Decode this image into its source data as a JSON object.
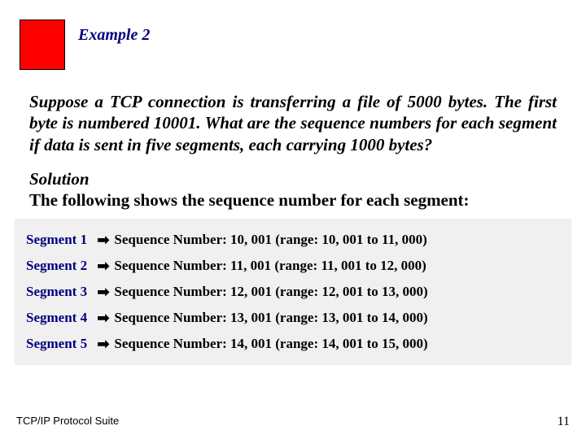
{
  "header": {
    "example_label": "Example 2"
  },
  "problem": {
    "text": "Suppose a TCP connection is transferring a file of 5000 bytes. The first byte is numbered 10001. What are the sequence numbers for each segment if data is sent in five segments, each carrying 1000 bytes?"
  },
  "solution": {
    "label": "Solution",
    "intro": "The following shows the sequence number for each segment:"
  },
  "segments": [
    {
      "label": "Segment 1 ",
      "text": "Sequence Number: 10, 001 (range: 10, 001 to 11, 000)"
    },
    {
      "label": "Segment 2 ",
      "text": "Sequence Number: 11, 001 (range: 11, 001 to 12, 000)"
    },
    {
      "label": "Segment 3 ",
      "text": "Sequence Number: 12, 001 (range: 12, 001 to 13, 000)"
    },
    {
      "label": "Segment 4 ",
      "text": "Sequence Number: 13, 001 (range: 13, 001 to 14, 000)"
    },
    {
      "label": "Segment 5 ",
      "text": "Sequence Number: 14, 001 (range: 14, 001 to 15, 000)"
    }
  ],
  "footer": {
    "left": "TCP/IP Protocol Suite",
    "page": "11"
  },
  "icons": {
    "arrow": "➡"
  }
}
